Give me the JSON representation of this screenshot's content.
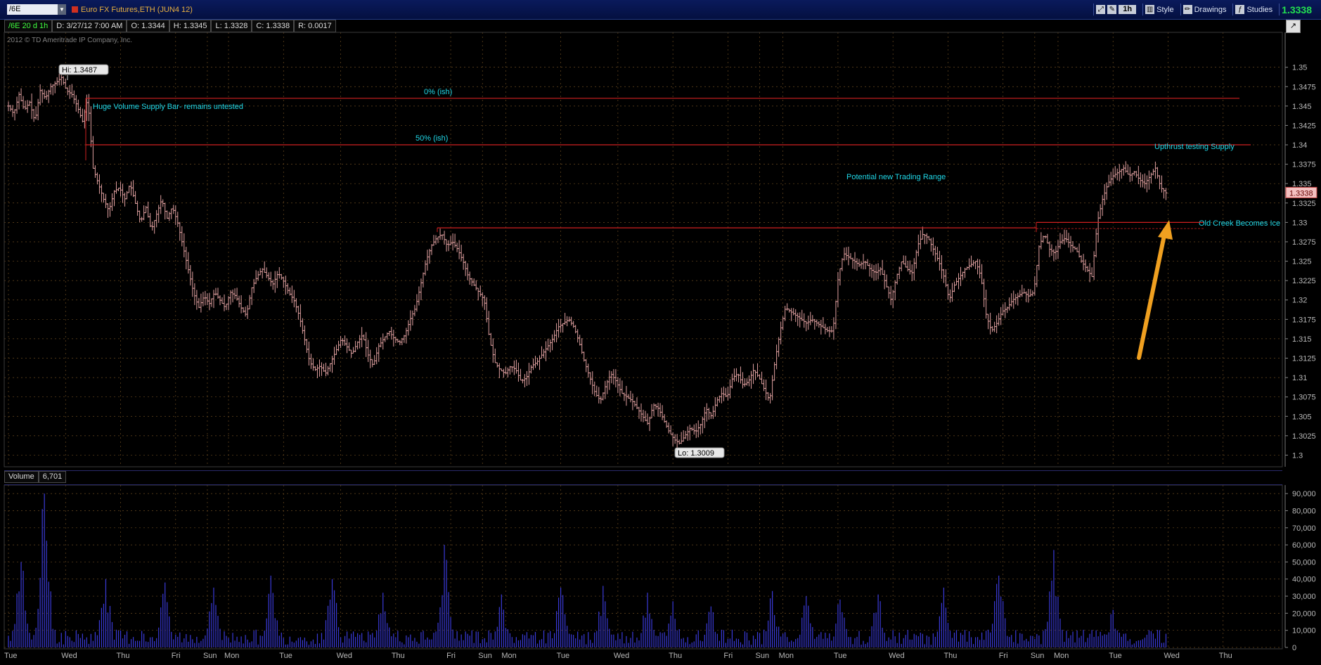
{
  "header": {
    "symbol": "/6E",
    "instrument_title": "Euro FX Futures,ETH (JUN4 12)",
    "timeframe": "1h",
    "style_label": "Style",
    "drawings_label": "Drawings",
    "studies_label": "Studies",
    "last_price": "1.3338"
  },
  "info": {
    "symbol_period": "/6E 20 d 1h",
    "date": "D: 3/27/12 7:00 AM",
    "open": "O: 1.3344",
    "high": "H: 1.3345",
    "low": "L: 1.3328",
    "close": "C: 1.3338",
    "range": "R: 0.0017"
  },
  "copyright": "2012 © TD Ameritrade IP Company, Inc.",
  "volume_pane": {
    "label": "Volume",
    "value": "6,701"
  },
  "colors": {
    "candle": "#e0a0a0",
    "volume": "#3a3ad8",
    "level_line": "#d02020",
    "annotation": "#20d8e8",
    "arrow": "#f0a020",
    "grid": "#6a4a20"
  },
  "chart_data": [
    {
      "type": "ohlc",
      "pane": "price",
      "ylim": [
        1.2985,
        1.3545
      ],
      "y_ticks": [
        "1.35",
        "1.3475",
        "1.345",
        "1.3425",
        "1.34",
        "1.3375",
        "1.335",
        "1.3325",
        "1.33",
        "1.3275",
        "1.325",
        "1.3225",
        "1.32",
        "1.3175",
        "1.315",
        "1.3125",
        "1.31",
        "1.3075",
        "1.305",
        "1.3025",
        "1.3"
      ],
      "x_labels": [
        "Tue",
        "Wed",
        "Thu",
        "Fri",
        "Sun",
        "Mon",
        "Tue",
        "Wed",
        "Thu",
        "Fri",
        "Sun",
        "Mon",
        "Tue",
        "Wed",
        "Thu",
        "Fri",
        "Sun",
        "Mon",
        "Tue",
        "Wed",
        "Thu",
        "Fri",
        "Sun",
        "Mon",
        "Tue",
        "Wed",
        "Thu"
      ],
      "x_label_bars": [
        0,
        27,
        53,
        79,
        94,
        104,
        130,
        157,
        183,
        209,
        224,
        235,
        261,
        288,
        314,
        340,
        355,
        366,
        392,
        418,
        444,
        470,
        485,
        496,
        522,
        548,
        574
      ],
      "closes": [
        1.345,
        1.344,
        1.3465,
        1.3445,
        1.3455,
        1.343,
        1.347,
        1.346,
        1.3475,
        1.348,
        1.3487,
        1.347,
        1.3465,
        1.345,
        1.343,
        1.346,
        1.337,
        1.335,
        1.333,
        1.3315,
        1.334,
        1.3345,
        1.333,
        1.335,
        1.3325,
        1.33,
        1.332,
        1.329,
        1.331,
        1.333,
        1.3305,
        1.332,
        1.33,
        1.327,
        1.324,
        1.321,
        1.319,
        1.3205,
        1.3195,
        1.321,
        1.32,
        1.319,
        1.321,
        1.3205,
        1.319,
        1.318,
        1.3215,
        1.323,
        1.324,
        1.323,
        1.322,
        1.3235,
        1.3225,
        1.321,
        1.32,
        1.318,
        1.315,
        1.312,
        1.311,
        1.3115,
        1.3105,
        1.312,
        1.3135,
        1.315,
        1.314,
        1.313,
        1.3145,
        1.3155,
        1.313,
        1.3115,
        1.314,
        1.315,
        1.316,
        1.315,
        1.3145,
        1.3155,
        1.3175,
        1.319,
        1.322,
        1.325,
        1.327,
        1.328,
        1.3285,
        1.327,
        1.3275,
        1.3265,
        1.325,
        1.323,
        1.322,
        1.321,
        1.32,
        1.315,
        1.312,
        1.311,
        1.3105,
        1.3115,
        1.311,
        1.3095,
        1.31,
        1.3115,
        1.312,
        1.313,
        1.314,
        1.315,
        1.3165,
        1.317,
        1.3175,
        1.3165,
        1.3145,
        1.312,
        1.31,
        1.308,
        1.307,
        1.309,
        1.3105,
        1.3095,
        1.308,
        1.3075,
        1.307,
        1.306,
        1.305,
        1.304,
        1.3065,
        1.306,
        1.3045,
        1.303,
        1.302,
        1.3015,
        1.3025,
        1.3035,
        1.303,
        1.304,
        1.306,
        1.305,
        1.307,
        1.308,
        1.3075,
        1.31,
        1.3105,
        1.309,
        1.3095,
        1.311,
        1.31,
        1.3085,
        1.307,
        1.312,
        1.316,
        1.319,
        1.3185,
        1.318,
        1.3175,
        1.317,
        1.3175,
        1.317,
        1.3165,
        1.316,
        1.316,
        1.323,
        1.326,
        1.3255,
        1.325,
        1.3245,
        1.325,
        1.324,
        1.3235,
        1.324,
        1.322,
        1.32,
        1.323,
        1.325,
        1.324,
        1.3235,
        1.327,
        1.3285,
        1.328,
        1.3265,
        1.325,
        1.323,
        1.32,
        1.322,
        1.323,
        1.324,
        1.3245,
        1.325,
        1.323,
        1.318,
        1.316,
        1.317,
        1.3185,
        1.319,
        1.32,
        1.3205,
        1.321,
        1.3205,
        1.321,
        1.327,
        1.3285,
        1.3265,
        1.326,
        1.3275,
        1.328,
        1.327,
        1.3265,
        1.325,
        1.324,
        1.323,
        1.33,
        1.333,
        1.335,
        1.336,
        1.3365,
        1.337,
        1.336,
        1.3365,
        1.3355,
        1.335,
        1.336,
        1.337,
        1.3345,
        1.3338
      ],
      "annotations": [
        {
          "kind": "label",
          "text": "Hi: 1.3487",
          "price": 1.3487
        },
        {
          "kind": "label",
          "text": "Lo: 1.3009",
          "price": 1.3009
        },
        {
          "kind": "hline",
          "price": 1.346,
          "text": "0% (ish)"
        },
        {
          "kind": "hline",
          "price": 1.34,
          "text": "50% (ish)"
        },
        {
          "kind": "text",
          "text": "Huge Volume Supply Bar- remains untested"
        },
        {
          "kind": "text",
          "text": "Potential new Trading Range"
        },
        {
          "kind": "text",
          "text": "Upthrust testing Supply"
        },
        {
          "kind": "text",
          "text": "Old Creek Becomes Ice"
        },
        {
          "kind": "hline",
          "price": 1.3293,
          "text": ""
        },
        {
          "kind": "hline",
          "price": 1.33,
          "text": ""
        },
        {
          "kind": "arrow",
          "text": ""
        }
      ],
      "current_price_label": "1.3338"
    },
    {
      "type": "bar",
      "pane": "volume",
      "ylim": [
        0,
        95000
      ],
      "y_ticks": [
        "90,000",
        "80,000",
        "70,000",
        "60,000",
        "50,000",
        "40,000",
        "30,000",
        "20,000",
        "10,000",
        "0"
      ],
      "peaks": [
        {
          "bar": 6,
          "value": 50000
        },
        {
          "bar": 17,
          "value": 90000
        },
        {
          "bar": 46,
          "value": 40000
        },
        {
          "bar": 74,
          "value": 38000
        },
        {
          "bar": 97,
          "value": 35000
        },
        {
          "bar": 124,
          "value": 42000
        },
        {
          "bar": 153,
          "value": 40000
        },
        {
          "bar": 177,
          "value": 32000
        },
        {
          "bar": 206,
          "value": 60000
        },
        {
          "bar": 233,
          "value": 31000
        },
        {
          "bar": 261,
          "value": 35000
        },
        {
          "bar": 281,
          "value": 36000
        },
        {
          "bar": 302,
          "value": 32000
        },
        {
          "bar": 314,
          "value": 27000
        },
        {
          "bar": 332,
          "value": 24000
        },
        {
          "bar": 361,
          "value": 33000
        },
        {
          "bar": 377,
          "value": 30000
        },
        {
          "bar": 393,
          "value": 28000
        },
        {
          "bar": 411,
          "value": 31000
        },
        {
          "bar": 442,
          "value": 35000
        },
        {
          "bar": 468,
          "value": 42000
        },
        {
          "bar": 494,
          "value": 57000
        },
        {
          "bar": 522,
          "value": 22000
        }
      ]
    }
  ]
}
